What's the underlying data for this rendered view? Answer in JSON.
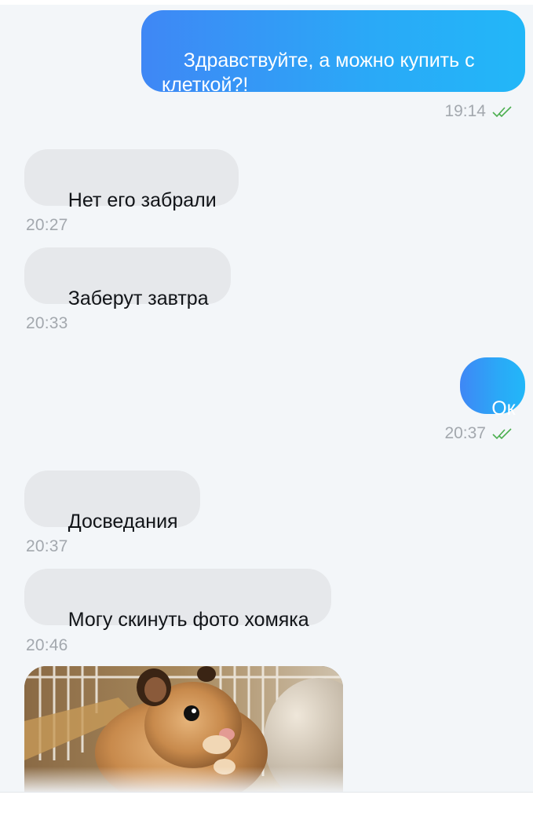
{
  "messages": [
    {
      "direction": "out",
      "text": "Здравствуйте, а можно купить с\nклеткой?!",
      "time": "19:14",
      "status": "read"
    },
    {
      "direction": "in",
      "text": "Нет его забрали",
      "time": "20:27"
    },
    {
      "direction": "in",
      "text": "Заберут завтра",
      "time": "20:33"
    },
    {
      "direction": "out",
      "text": "Ок",
      "time": "20:37",
      "status": "read"
    },
    {
      "direction": "in",
      "text": "Досведания",
      "time": "20:37"
    },
    {
      "direction": "in",
      "text": "Могу скинуть фото хомяка",
      "time": "20:46"
    }
  ],
  "photo": {
    "subject": "hamster-photo"
  },
  "colors": {
    "background": "#f3f6f9",
    "incoming_bubble": "#e6e8eb",
    "outgoing_gradient_start": "#3f87f5",
    "outgoing_gradient_end": "#22b7f8",
    "timestamp": "#a3a8ae",
    "read_check": "#4caf50"
  },
  "icons": {
    "read_receipt": "double-check-icon"
  }
}
